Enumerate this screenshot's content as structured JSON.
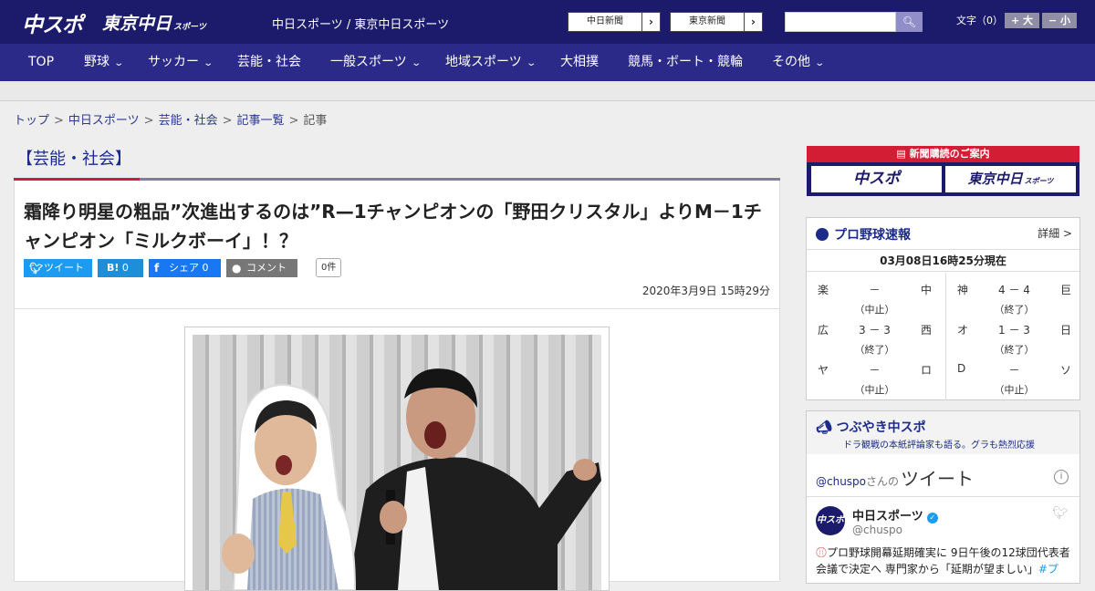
{
  "header": {
    "logo_primary": "中スポ",
    "logo_secondary": "東京中日",
    "logo_secondary_small": "スポーツ",
    "site_names": "中日スポーツ / 東京中日スポーツ",
    "newspaper_links": [
      "中日新聞",
      "東京新聞"
    ],
    "search_placeholder": "",
    "font_size_label": "文字（0）",
    "font_increase": "+ 大",
    "font_decrease": "− 小",
    "colors": {
      "header_bg": "#1b1a6b",
      "nav_bg": "#2c2a88",
      "accent_red": "#d21d34"
    }
  },
  "nav": {
    "items": [
      {
        "label": "TOP",
        "dropdown": false
      },
      {
        "label": "野球",
        "dropdown": true
      },
      {
        "label": "サッカー",
        "dropdown": true
      },
      {
        "label": "芸能・社会",
        "dropdown": false
      },
      {
        "label": "一般スポーツ",
        "dropdown": true
      },
      {
        "label": "地域スポーツ",
        "dropdown": true
      },
      {
        "label": "大相撲",
        "dropdown": false
      },
      {
        "label": "競馬・ボート・競輪",
        "dropdown": false
      },
      {
        "label": "その他",
        "dropdown": true
      }
    ]
  },
  "breadcrumb": {
    "items": [
      "トップ",
      "中日スポーツ",
      "芸能・社会",
      "記事一覧",
      "記事"
    ],
    "separator": ">"
  },
  "article": {
    "category": "【芸能・社会】",
    "headline": "霜降り明星の粗品”次進出するのは”R—1チャンピオンの「野田クリスタル」よりM－1チャンピオン「ミルクボーイ」！？",
    "share": {
      "tweet": "ツイート",
      "hatena_icon": "B!",
      "hatena_count": "0",
      "facebook": "シェア",
      "facebook_count": "0",
      "comment": "コメント",
      "comment_count": "0件"
    },
    "date": "2020年3月9日 15時29分"
  },
  "sidebar": {
    "subscription": {
      "label": "新聞購読のご案内",
      "papers": [
        "中スポ",
        "東京中日"
      ],
      "paper_small": "スポーツ"
    },
    "scores": {
      "title": "プロ野球速報",
      "detail_link": "詳細 >",
      "updated": "03月08日16時25分現在",
      "games": [
        {
          "home": "楽",
          "away": "中",
          "score": "－",
          "status": "（中止）"
        },
        {
          "home": "神",
          "away": "巨",
          "score": "4 － 4",
          "status": "（終了）"
        },
        {
          "home": "広",
          "away": "西",
          "score": "3 － 3",
          "status": "（終了）"
        },
        {
          "home": "オ",
          "away": "日",
          "score": "1 － 3",
          "status": "（終了）"
        },
        {
          "home": "ヤ",
          "away": "ロ",
          "score": "－",
          "status": "（中止）"
        },
        {
          "home": "D",
          "away": "ソ",
          "score": "－",
          "status": "（中止）"
        }
      ]
    },
    "tweets": {
      "title": "つぶやき中スポ",
      "subtitle": "ドラ観戦の本紙評論家も語る。グラも熱烈応援",
      "owner_handle": "@chuspo",
      "owner_suffix": "さんの",
      "owner_big": "ツイート",
      "tweet": {
        "avatar_text": "中スポ",
        "name": "中日スポーツ",
        "handle": "@chuspo",
        "text": "プロ野球開幕延期確実に 9日午後の12球団代表者会議で決定へ 専門家から「延期が望ましい」",
        "hashtag": "#プ"
      }
    }
  }
}
